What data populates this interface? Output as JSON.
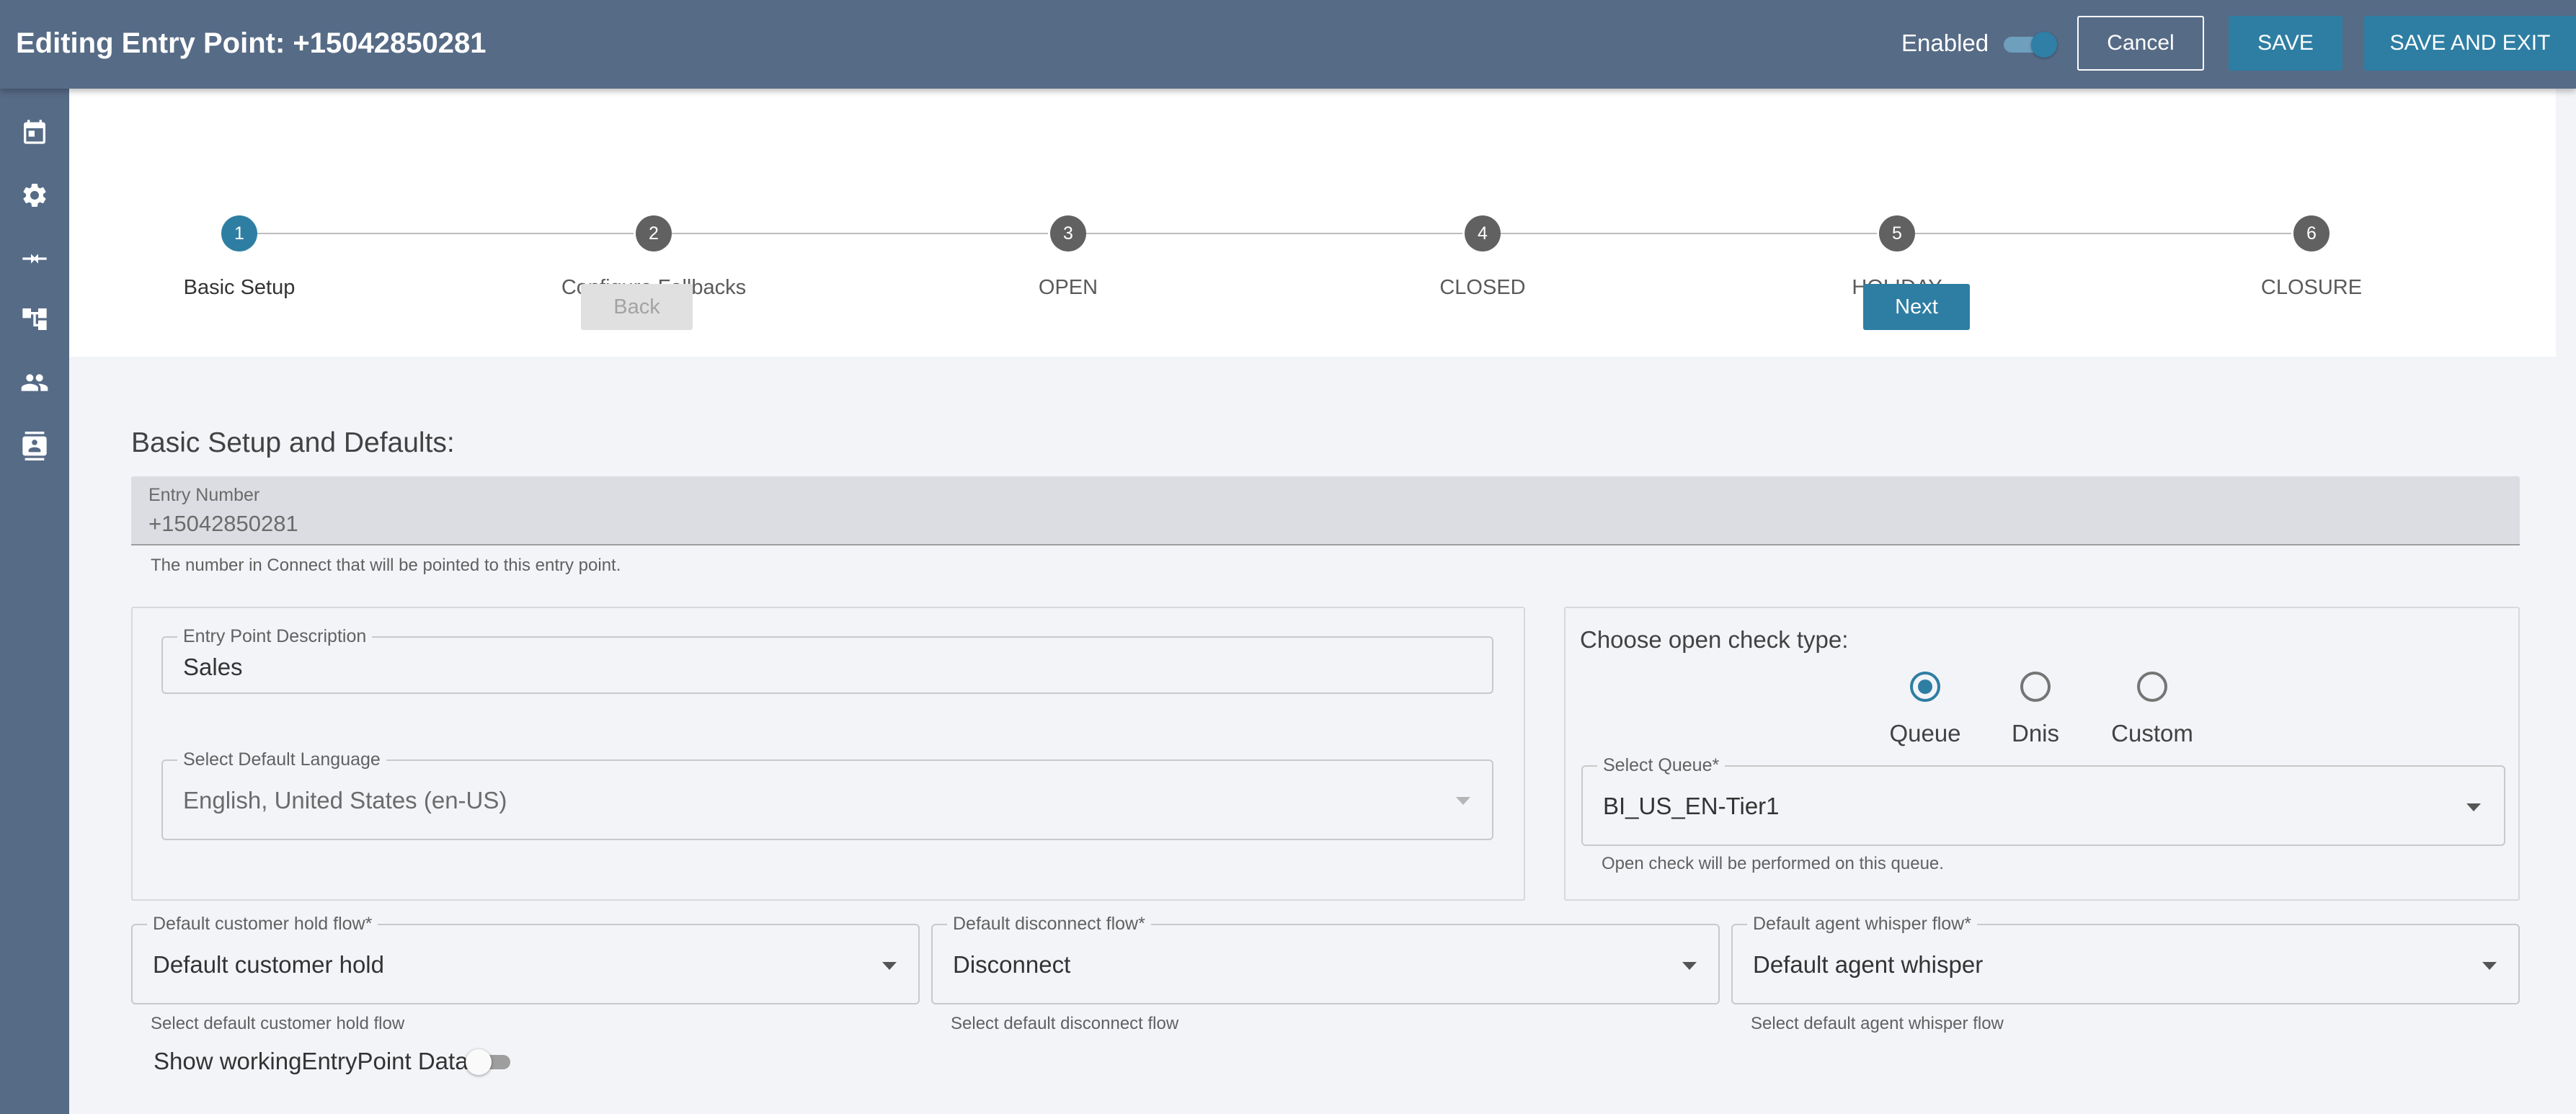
{
  "header": {
    "title": "Editing Entry Point: +15042850281",
    "enabled_label": "Enabled",
    "enabled": true,
    "cancel_label": "Cancel",
    "save_label": "SAVE",
    "save_exit_label": "SAVE AND EXIT"
  },
  "sidebar": {
    "items": [
      {
        "icon": "calendar-icon"
      },
      {
        "icon": "gear-icon"
      },
      {
        "icon": "merge-arrows-icon"
      },
      {
        "icon": "hierarchy-icon"
      },
      {
        "icon": "people-icon"
      },
      {
        "icon": "contact-card-icon"
      }
    ]
  },
  "stepper": {
    "steps": [
      {
        "number": "1",
        "label": "Basic Setup",
        "active": true
      },
      {
        "number": "2",
        "label": "Configure Fallbacks",
        "active": false
      },
      {
        "number": "3",
        "label": "OPEN",
        "active": false
      },
      {
        "number": "4",
        "label": "CLOSED",
        "active": false
      },
      {
        "number": "5",
        "label": "HOLIDAY",
        "active": false
      },
      {
        "number": "6",
        "label": "CLOSURE",
        "active": false
      }
    ],
    "back_label": "Back",
    "next_label": "Next"
  },
  "form": {
    "section_title": "Basic Setup and Defaults:",
    "entry_number": {
      "label": "Entry Number",
      "value": "+15042850281",
      "helper": "The number in Connect that will be pointed to this entry point."
    },
    "description": {
      "label": "Entry Point Description",
      "value": "Sales"
    },
    "language": {
      "label": "Select Default Language",
      "value": "English, United States (en-US)"
    },
    "open_check": {
      "title": "Choose open check type:",
      "options": [
        {
          "label": "Queue",
          "checked": true
        },
        {
          "label": "Dnis",
          "checked": false
        },
        {
          "label": "Custom",
          "checked": false
        }
      ],
      "queue_label": "Select Queue*",
      "queue_value": "BI_US_EN-Tier1",
      "queue_helper": "Open check will be performed on this queue."
    },
    "hold_flow": {
      "label": "Default customer hold flow*",
      "value": "Default customer hold",
      "helper": "Select default customer hold flow"
    },
    "disconnect_flow": {
      "label": "Default disconnect flow*",
      "value": "Disconnect",
      "helper": "Select default disconnect flow"
    },
    "whisper_flow": {
      "label": "Default agent whisper flow*",
      "value": "Default agent whisper",
      "helper": "Select default agent whisper flow"
    },
    "working_toggle_label": "Show workingEntryPoint Data",
    "working_toggle_on": false
  },
  "colors": {
    "header_bg": "#566b86",
    "accent": "#2e7ea3",
    "page_bg": "#f3f4f8"
  }
}
